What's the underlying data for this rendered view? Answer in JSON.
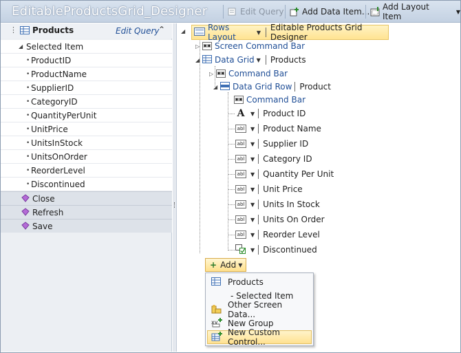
{
  "window": {
    "title": "EditableProductsGrid_Designer"
  },
  "toolbar": {
    "edit_query": "Edit Query",
    "add_data_item": "Add Data Item...",
    "add_layout_item": "Add Layout Item"
  },
  "left_panel": {
    "entity": "Products",
    "edit_query_link": "Edit Query",
    "selected_item": "Selected Item",
    "fields": [
      "ProductID",
      "ProductName",
      "SupplierID",
      "CategoryID",
      "QuantityPerUnit",
      "UnitPrice",
      "UnitsInStock",
      "UnitsOnOrder",
      "ReorderLevel",
      "Discontinued"
    ],
    "actions": [
      "Close",
      "Refresh",
      "Save"
    ]
  },
  "tree": {
    "root_layout": "Rows Layout",
    "root_name": "Editable Products Grid Designer",
    "screen_command_bar": "Screen Command Bar",
    "data_grid": "Data Grid",
    "data_grid_source": "Products",
    "grid_command_bar": "Command Bar",
    "data_grid_row": "Data Grid Row",
    "data_grid_row_source": "Product",
    "row_command_bar": "Command Bar",
    "columns": [
      {
        "icon": "label-A-icon",
        "label": "Product ID"
      },
      {
        "icon": "textbox-icon",
        "label": "Product Name"
      },
      {
        "icon": "textbox-icon",
        "label": "Supplier ID"
      },
      {
        "icon": "textbox-icon",
        "label": "Category ID"
      },
      {
        "icon": "textbox-icon",
        "label": "Quantity Per Unit"
      },
      {
        "icon": "textbox-icon",
        "label": "Unit Price"
      },
      {
        "icon": "textbox-icon",
        "label": "Units In Stock"
      },
      {
        "icon": "textbox-icon",
        "label": "Units On Order"
      },
      {
        "icon": "textbox-icon",
        "label": "Reorder Level"
      },
      {
        "icon": "checkbox-icon",
        "label": "Discontinued"
      }
    ],
    "textbox_glyph": "abl",
    "add_button": "Add"
  },
  "add_menu": {
    "items": [
      "Products",
      "- Selected Item",
      "Other Screen Data...",
      "New Group",
      "New Custom Control..."
    ]
  },
  "colors": {
    "accent_blue": "#1f4e96",
    "highlight": "#ffe391",
    "panel_bg": "#eceff3"
  }
}
